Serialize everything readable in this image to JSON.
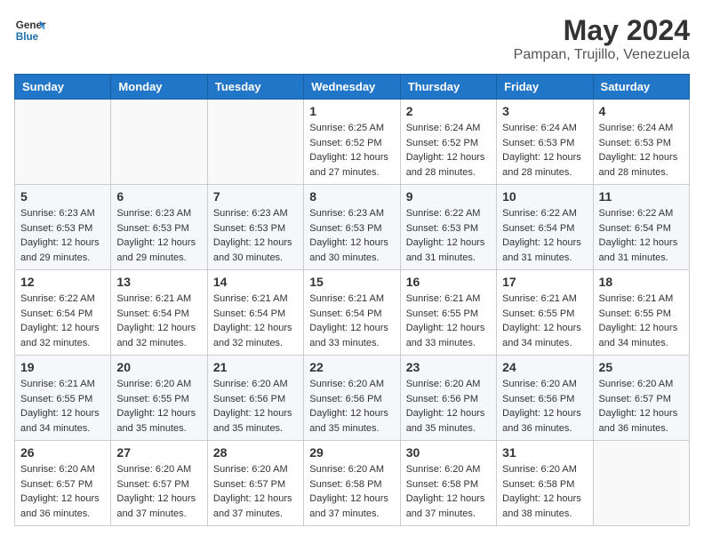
{
  "header": {
    "logo_line1": "General",
    "logo_line2": "Blue",
    "month_title": "May 2024",
    "location": "Pampan, Trujillo, Venezuela"
  },
  "days_of_week": [
    "Sunday",
    "Monday",
    "Tuesday",
    "Wednesday",
    "Thursday",
    "Friday",
    "Saturday"
  ],
  "weeks": [
    [
      {
        "num": "",
        "info": ""
      },
      {
        "num": "",
        "info": ""
      },
      {
        "num": "",
        "info": ""
      },
      {
        "num": "1",
        "info": "Sunrise: 6:25 AM\nSunset: 6:52 PM\nDaylight: 12 hours\nand 27 minutes."
      },
      {
        "num": "2",
        "info": "Sunrise: 6:24 AM\nSunset: 6:52 PM\nDaylight: 12 hours\nand 28 minutes."
      },
      {
        "num": "3",
        "info": "Sunrise: 6:24 AM\nSunset: 6:53 PM\nDaylight: 12 hours\nand 28 minutes."
      },
      {
        "num": "4",
        "info": "Sunrise: 6:24 AM\nSunset: 6:53 PM\nDaylight: 12 hours\nand 28 minutes."
      }
    ],
    [
      {
        "num": "5",
        "info": "Sunrise: 6:23 AM\nSunset: 6:53 PM\nDaylight: 12 hours\nand 29 minutes."
      },
      {
        "num": "6",
        "info": "Sunrise: 6:23 AM\nSunset: 6:53 PM\nDaylight: 12 hours\nand 29 minutes."
      },
      {
        "num": "7",
        "info": "Sunrise: 6:23 AM\nSunset: 6:53 PM\nDaylight: 12 hours\nand 30 minutes."
      },
      {
        "num": "8",
        "info": "Sunrise: 6:23 AM\nSunset: 6:53 PM\nDaylight: 12 hours\nand 30 minutes."
      },
      {
        "num": "9",
        "info": "Sunrise: 6:22 AM\nSunset: 6:53 PM\nDaylight: 12 hours\nand 31 minutes."
      },
      {
        "num": "10",
        "info": "Sunrise: 6:22 AM\nSunset: 6:54 PM\nDaylight: 12 hours\nand 31 minutes."
      },
      {
        "num": "11",
        "info": "Sunrise: 6:22 AM\nSunset: 6:54 PM\nDaylight: 12 hours\nand 31 minutes."
      }
    ],
    [
      {
        "num": "12",
        "info": "Sunrise: 6:22 AM\nSunset: 6:54 PM\nDaylight: 12 hours\nand 32 minutes."
      },
      {
        "num": "13",
        "info": "Sunrise: 6:21 AM\nSunset: 6:54 PM\nDaylight: 12 hours\nand 32 minutes."
      },
      {
        "num": "14",
        "info": "Sunrise: 6:21 AM\nSunset: 6:54 PM\nDaylight: 12 hours\nand 32 minutes."
      },
      {
        "num": "15",
        "info": "Sunrise: 6:21 AM\nSunset: 6:54 PM\nDaylight: 12 hours\nand 33 minutes."
      },
      {
        "num": "16",
        "info": "Sunrise: 6:21 AM\nSunset: 6:55 PM\nDaylight: 12 hours\nand 33 minutes."
      },
      {
        "num": "17",
        "info": "Sunrise: 6:21 AM\nSunset: 6:55 PM\nDaylight: 12 hours\nand 34 minutes."
      },
      {
        "num": "18",
        "info": "Sunrise: 6:21 AM\nSunset: 6:55 PM\nDaylight: 12 hours\nand 34 minutes."
      }
    ],
    [
      {
        "num": "19",
        "info": "Sunrise: 6:21 AM\nSunset: 6:55 PM\nDaylight: 12 hours\nand 34 minutes."
      },
      {
        "num": "20",
        "info": "Sunrise: 6:20 AM\nSunset: 6:55 PM\nDaylight: 12 hours\nand 35 minutes."
      },
      {
        "num": "21",
        "info": "Sunrise: 6:20 AM\nSunset: 6:56 PM\nDaylight: 12 hours\nand 35 minutes."
      },
      {
        "num": "22",
        "info": "Sunrise: 6:20 AM\nSunset: 6:56 PM\nDaylight: 12 hours\nand 35 minutes."
      },
      {
        "num": "23",
        "info": "Sunrise: 6:20 AM\nSunset: 6:56 PM\nDaylight: 12 hours\nand 35 minutes."
      },
      {
        "num": "24",
        "info": "Sunrise: 6:20 AM\nSunset: 6:56 PM\nDaylight: 12 hours\nand 36 minutes."
      },
      {
        "num": "25",
        "info": "Sunrise: 6:20 AM\nSunset: 6:57 PM\nDaylight: 12 hours\nand 36 minutes."
      }
    ],
    [
      {
        "num": "26",
        "info": "Sunrise: 6:20 AM\nSunset: 6:57 PM\nDaylight: 12 hours\nand 36 minutes."
      },
      {
        "num": "27",
        "info": "Sunrise: 6:20 AM\nSunset: 6:57 PM\nDaylight: 12 hours\nand 37 minutes."
      },
      {
        "num": "28",
        "info": "Sunrise: 6:20 AM\nSunset: 6:57 PM\nDaylight: 12 hours\nand 37 minutes."
      },
      {
        "num": "29",
        "info": "Sunrise: 6:20 AM\nSunset: 6:58 PM\nDaylight: 12 hours\nand 37 minutes."
      },
      {
        "num": "30",
        "info": "Sunrise: 6:20 AM\nSunset: 6:58 PM\nDaylight: 12 hours\nand 37 minutes."
      },
      {
        "num": "31",
        "info": "Sunrise: 6:20 AM\nSunset: 6:58 PM\nDaylight: 12 hours\nand 38 minutes."
      },
      {
        "num": "",
        "info": ""
      }
    ]
  ]
}
